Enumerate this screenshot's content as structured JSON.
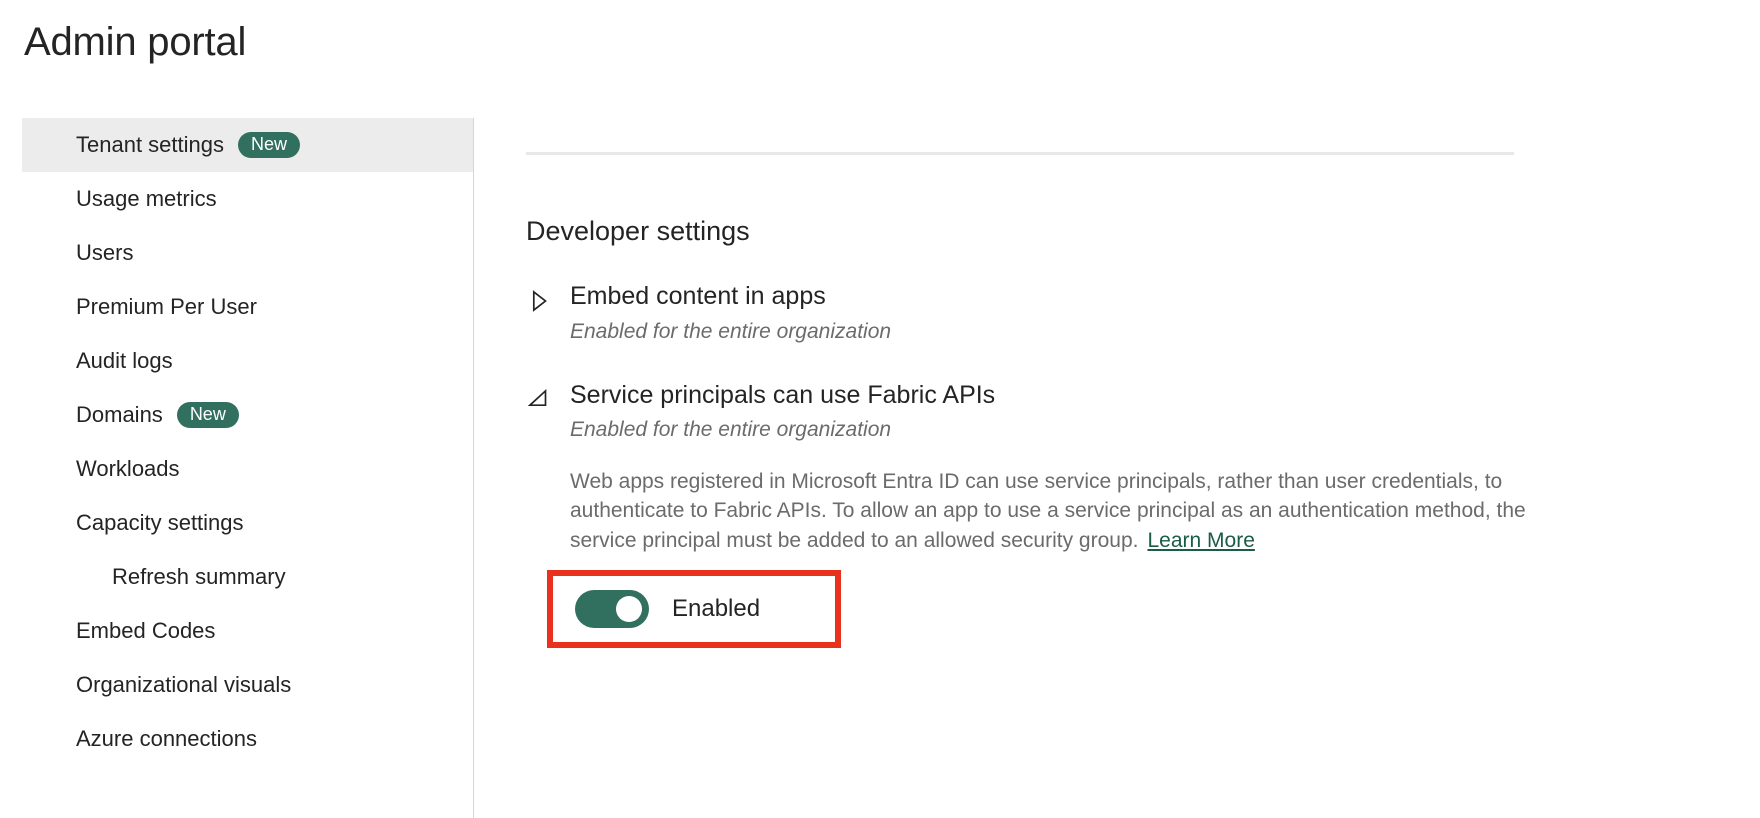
{
  "page": {
    "title": "Admin portal"
  },
  "sidebar": {
    "items": [
      {
        "label": "Tenant settings",
        "badge": "New",
        "selected": true,
        "sub": false
      },
      {
        "label": "Usage metrics",
        "badge": "",
        "selected": false,
        "sub": false
      },
      {
        "label": "Users",
        "badge": "",
        "selected": false,
        "sub": false
      },
      {
        "label": "Premium Per User",
        "badge": "",
        "selected": false,
        "sub": false
      },
      {
        "label": "Audit logs",
        "badge": "",
        "selected": false,
        "sub": false
      },
      {
        "label": "Domains",
        "badge": "New",
        "selected": false,
        "sub": false
      },
      {
        "label": "Workloads",
        "badge": "",
        "selected": false,
        "sub": false
      },
      {
        "label": "Capacity settings",
        "badge": "",
        "selected": false,
        "sub": false
      },
      {
        "label": "Refresh summary",
        "badge": "",
        "selected": false,
        "sub": true
      },
      {
        "label": "Embed Codes",
        "badge": "",
        "selected": false,
        "sub": false
      },
      {
        "label": "Organizational visuals",
        "badge": "",
        "selected": false,
        "sub": false
      },
      {
        "label": "Azure connections",
        "badge": "",
        "selected": false,
        "sub": false
      }
    ]
  },
  "main": {
    "section_title": "Developer settings",
    "settings": [
      {
        "name": "Embed content in apps",
        "status": "Enabled for the entire organization",
        "expanded": false,
        "chevron": "chevron-right-icon"
      },
      {
        "name": "Service principals can use Fabric APIs",
        "status": "Enabled for the entire organization",
        "expanded": true,
        "chevron": "chevron-down-icon",
        "description": "Web apps registered in Microsoft Entra ID can use service principals, rather than user credentials, to authenticate to Fabric APIs. To allow an app to use a service principal as an authentication method, the service principal must be added to an allowed security group.",
        "learn_more_label": "Learn More",
        "toggle": {
          "state": "on",
          "label": "Enabled"
        }
      }
    ]
  },
  "colors": {
    "accent_green": "#31705E",
    "link_green": "#1a5c45",
    "highlight_red": "#e8321e",
    "selected_row": "#ececec",
    "muted_text": "#6b6b6b"
  }
}
